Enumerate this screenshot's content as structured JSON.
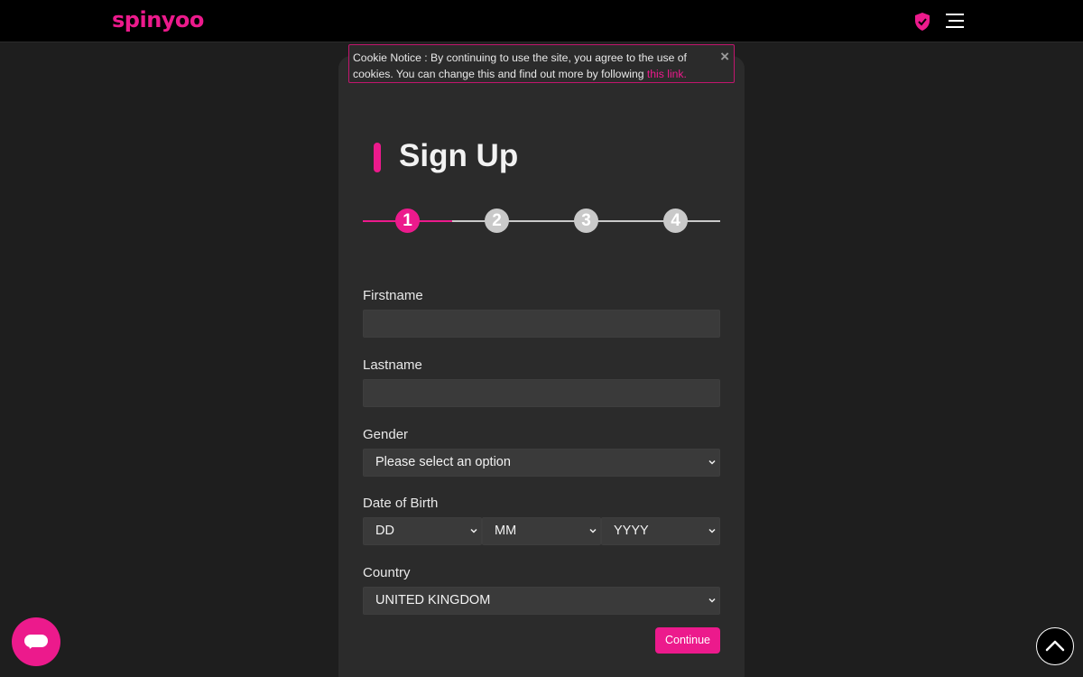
{
  "header": {
    "logo_text": "spinyoo",
    "accent_color": "#ec1a8c"
  },
  "cookie": {
    "text": "Cookie Notice : By continuing to use the site, you agree to the use of cookies. You can change this and find out more by following ",
    "link_text": "this link.",
    "close_symbol": "×"
  },
  "signup": {
    "title": "Sign Up",
    "steps": [
      "1",
      "2",
      "3",
      "4"
    ],
    "active_step": 1
  },
  "form": {
    "firstname_label": "Firstname",
    "firstname_value": "",
    "lastname_label": "Lastname",
    "lastname_value": "",
    "gender_label": "Gender",
    "gender_value": "Please select an option",
    "dob_label": "Date of Birth",
    "dob_day": "DD",
    "dob_month": "MM",
    "dob_year": "YYYY",
    "country_label": "Country",
    "country_value": "UNITED KINGDOM",
    "continue_label": "Continue"
  },
  "icons": {
    "shield": "shield-check-icon",
    "menu": "hamburger-menu-icon",
    "chat": "chat-icon",
    "scroll_top": "chevron-up-icon"
  }
}
